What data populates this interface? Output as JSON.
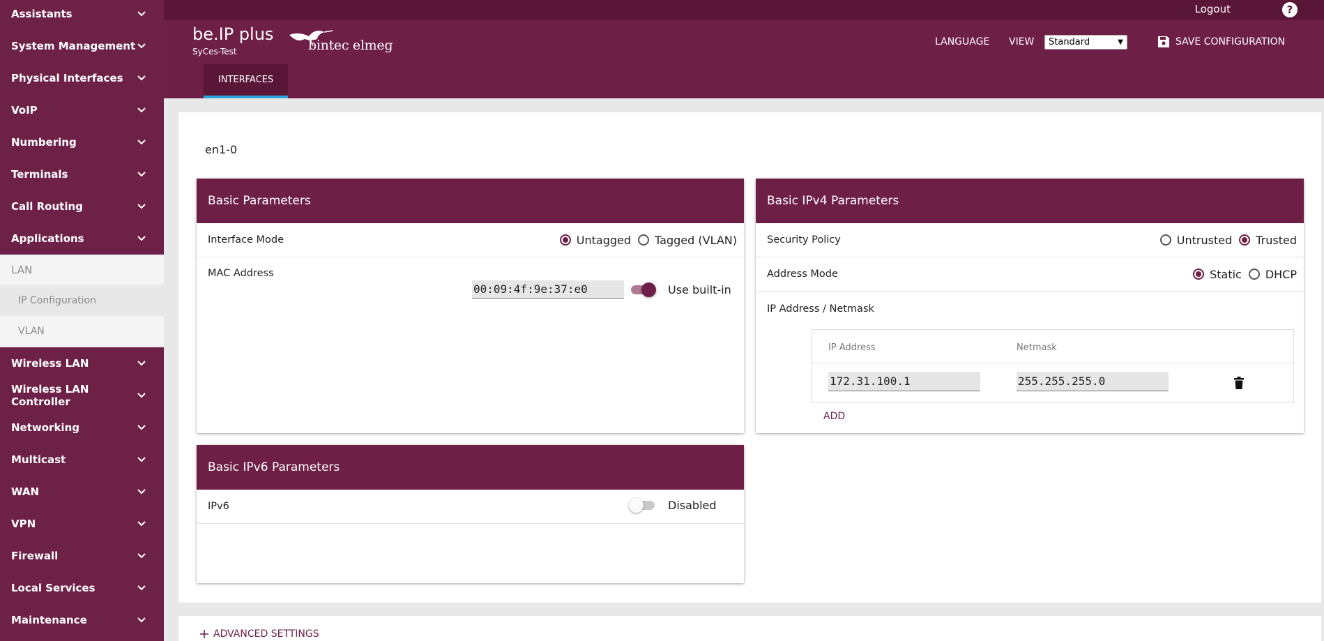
{
  "sidebar": {
    "items_top": [
      {
        "label": "Assistants"
      },
      {
        "label": "System Management"
      },
      {
        "label": "Physical Interfaces"
      },
      {
        "label": "VoIP"
      },
      {
        "label": "Numbering"
      },
      {
        "label": "Terminals"
      },
      {
        "label": "Call Routing"
      },
      {
        "label": "Applications"
      }
    ],
    "expanded": {
      "label": "LAN",
      "children": [
        {
          "label": "IP Configuration"
        },
        {
          "label": "VLAN"
        }
      ]
    },
    "items_bottom": [
      {
        "label": "Wireless LAN"
      },
      {
        "label": "Wireless LAN Controller"
      },
      {
        "label": "Networking"
      },
      {
        "label": "Multicast"
      },
      {
        "label": "WAN"
      },
      {
        "label": "VPN"
      },
      {
        "label": "Firewall"
      },
      {
        "label": "Local Services"
      },
      {
        "label": "Maintenance"
      }
    ]
  },
  "topbar": {
    "logout": "Logout",
    "help": "?"
  },
  "header": {
    "product": "be.IP plus",
    "device": "SyCes-Test",
    "logo_text": "bintec elmeg",
    "language_label": "LANGUAGE",
    "view_label": "VIEW",
    "view_selected": "Standard",
    "save_label": "SAVE CONFIGURATION",
    "tab": "INTERFACES"
  },
  "main": {
    "interface_name": "en1-0",
    "basic": {
      "title": "Basic Parameters",
      "interface_mode_label": "Interface Mode",
      "mode_options": [
        "Untagged",
        "Tagged (VLAN)"
      ],
      "mode_selected": "Untagged",
      "mac_label": "MAC Address",
      "mac_value": "00:09:4f:9e:37:e0",
      "use_builtin_label": "Use built-in",
      "use_builtin_on": true
    },
    "ipv4": {
      "title": "Basic IPv4 Parameters",
      "security_label": "Security Policy",
      "security_options": [
        "Untrusted",
        "Trusted"
      ],
      "security_selected": "Trusted",
      "address_mode_label": "Address Mode",
      "address_mode_options": [
        "Static",
        "DHCP"
      ],
      "address_mode_selected": "Static",
      "ip_netmask_label": "IP Address / Netmask",
      "col_ip": "IP Address",
      "col_netmask": "Netmask",
      "ip_value": "172.31.100.1",
      "netmask_value": "255.255.255.0",
      "add_label": "ADD"
    },
    "ipv6": {
      "title": "Basic IPv6 Parameters",
      "ipv6_label": "IPv6",
      "state_label": "Disabled",
      "enabled": false
    },
    "advanced_label": "ADVANCED SETTINGS"
  }
}
